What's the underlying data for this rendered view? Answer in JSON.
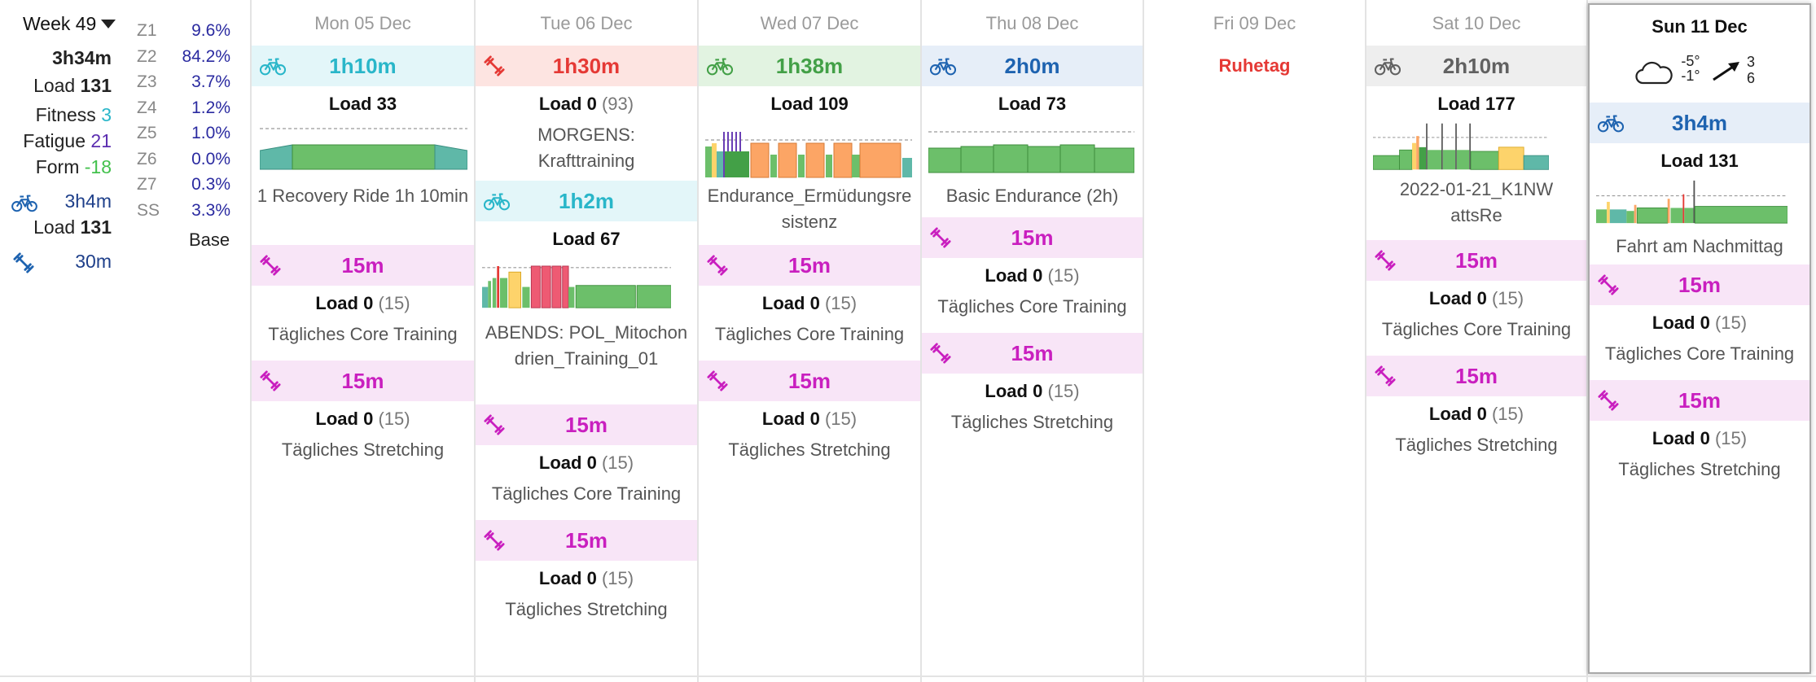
{
  "week": {
    "title": "Week 49",
    "total_time": "3h34m",
    "load_label": "Load",
    "load_value": "131",
    "fitness_label": "Fitness",
    "fitness_value": "3",
    "fatigue_label": "Fatigue",
    "fatigue_value": "21",
    "form_label": "Form",
    "form_value": "-18",
    "ride_time": "3h4m",
    "ride_load_label": "Load",
    "ride_load_value": "131",
    "strength_time": "30m",
    "zones": [
      {
        "name": "Z1",
        "value": "9.6%"
      },
      {
        "name": "Z2",
        "value": "84.2%"
      },
      {
        "name": "Z3",
        "value": "3.7%"
      },
      {
        "name": "Z4",
        "value": "1.2%"
      },
      {
        "name": "Z5",
        "value": "1.0%"
      },
      {
        "name": "Z6",
        "value": "0.0%"
      },
      {
        "name": "Z7",
        "value": "0.3%"
      },
      {
        "name": "SS",
        "value": "3.3%"
      }
    ],
    "phase": "Base"
  },
  "colors": {
    "ride_cyan": "#29b6c9",
    "strength_red": "#e53935",
    "ride_green": "#43a047",
    "ride_blue": "#1e63b0",
    "ride_gray": "#616161",
    "stretch_magenta": "#c91fbf",
    "stretch_bg": "#f8e5f7",
    "form_green": "#43c14d",
    "fatigue_purple": "#5b2db0",
    "fitness_cyan": "#29b6c9"
  },
  "days": {
    "mon": {
      "header": "Mon 05 Dec",
      "a1": {
        "duration": "1h10m",
        "load": "Load 33",
        "name": "1 Recovery Ride 1h 10min"
      },
      "s1": {
        "duration": "15m",
        "load": "Load 0",
        "paren": "(15)",
        "name": "Tägliches Core Training"
      },
      "s2": {
        "duration": "15m",
        "load": "Load 0",
        "paren": "(15)",
        "name": "Tägliches Stretching"
      }
    },
    "tue": {
      "header": "Tue 06 Dec",
      "a1": {
        "duration": "1h30m",
        "load": "Load 0",
        "paren": "(93)",
        "name": "MORGENS: Krafttraining"
      },
      "a2": {
        "duration": "1h2m",
        "load": "Load 67",
        "name": "ABENDS: POL_Mitochondrien_Training_01"
      },
      "s1": {
        "duration": "15m",
        "load": "Load 0",
        "paren": "(15)",
        "name": "Tägliches Core Training"
      },
      "s2": {
        "duration": "15m",
        "load": "Load 0",
        "paren": "(15)",
        "name": "Tägliches Stretching"
      }
    },
    "wed": {
      "header": "Wed 07 Dec",
      "a1": {
        "duration": "1h38m",
        "load": "Load 109",
        "name": "Endurance_Ermüdungsresistenz"
      },
      "s1": {
        "duration": "15m",
        "load": "Load 0",
        "paren": "(15)",
        "name": "Tägliches Core Training"
      },
      "s2": {
        "duration": "15m",
        "load": "Load 0",
        "paren": "(15)",
        "name": "Tägliches Stretching"
      }
    },
    "thu": {
      "header": "Thu 08 Dec",
      "a1": {
        "duration": "2h0m",
        "load": "Load 73",
        "name": "Basic Endurance (2h)"
      },
      "s1": {
        "duration": "15m",
        "load": "Load 0",
        "paren": "(15)",
        "name": "Tägliches Core Training"
      },
      "s2": {
        "duration": "15m",
        "load": "Load 0",
        "paren": "(15)",
        "name": "Tägliches Stretching"
      }
    },
    "fri": {
      "header": "Fri 09 Dec",
      "rest": "Ruhetag"
    },
    "sat": {
      "header": "Sat 10 Dec",
      "a1": {
        "duration": "2h10m",
        "load": "Load 177",
        "name": "2022-01-21_K1NWattsRe"
      },
      "s1": {
        "duration": "15m",
        "load": "Load 0",
        "paren": "(15)",
        "name": "Tägliches Core Training"
      },
      "s2": {
        "duration": "15m",
        "load": "Load 0",
        "paren": "(15)",
        "name": "Tägliches Stretching"
      }
    },
    "sun": {
      "header": "Sun 11 Dec",
      "weather": {
        "temp_high": "-5°",
        "temp_low": "-1°",
        "wind_top": "3",
        "wind_bottom": "6"
      },
      "a1": {
        "duration": "3h4m",
        "load": "Load 131",
        "name": "Fahrt am Nachmittag"
      },
      "s1": {
        "duration": "15m",
        "load": "Load 0",
        "paren": "(15)",
        "name": "Tägliches Core Training"
      },
      "s2": {
        "duration": "15m",
        "load": "Load 0",
        "paren": "(15)",
        "name": "Tägliches Stretching"
      }
    }
  }
}
